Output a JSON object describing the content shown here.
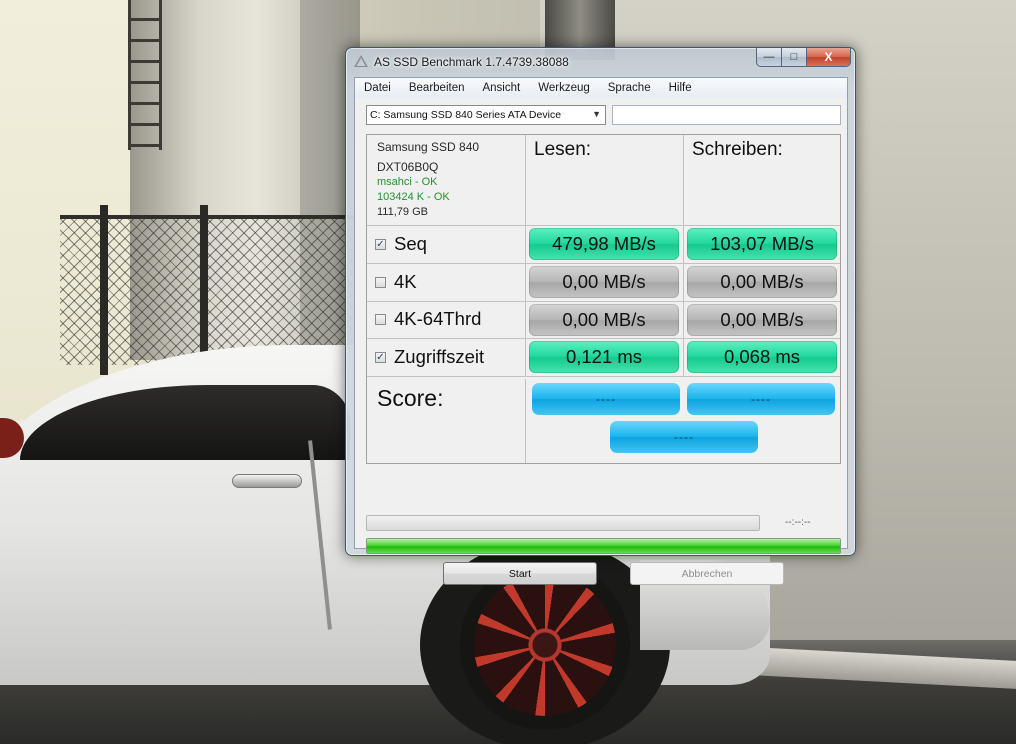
{
  "window": {
    "title": "AS SSD Benchmark 1.7.4739.38088",
    "caption": {
      "minimize": "—",
      "maximize": "□",
      "close": "X"
    }
  },
  "menu": [
    "Datei",
    "Bearbeiten",
    "Ansicht",
    "Werkzeug",
    "Sprache",
    "Hilfe"
  ],
  "drive": {
    "selected": "C: Samsung SSD 840 Series ATA Device",
    "extra_field": ""
  },
  "info": {
    "model": "Samsung SSD 840",
    "firmware": "DXT06B0Q",
    "driver_status": "msahci - OK",
    "alignment_status": "103424 K - OK",
    "capacity": "111,79 GB"
  },
  "columns": {
    "read": "Lesen:",
    "write": "Schreiben:"
  },
  "tests": [
    {
      "label": "Seq",
      "checked": true,
      "read": "479,98 MB/s",
      "write": "103,07 MB/s",
      "state": "done"
    },
    {
      "label": "4K",
      "checked": false,
      "read": "0,00 MB/s",
      "write": "0,00 MB/s",
      "state": "skipped"
    },
    {
      "label": "4K-64Thrd",
      "checked": false,
      "read": "0,00 MB/s",
      "write": "0,00 MB/s",
      "state": "skipped"
    },
    {
      "label": "Zugriffszeit",
      "checked": true,
      "read": "0,121 ms",
      "write": "0,068 ms",
      "state": "done"
    }
  ],
  "score": {
    "label": "Score:",
    "read": "----",
    "write": "----",
    "total": "----"
  },
  "progress": {
    "time_readout": "--:--:--",
    "overall_fraction": 1.0
  },
  "buttons": {
    "start": "Start",
    "cancel": "Abbrechen"
  },
  "colors": {
    "result_green": "#22d89d",
    "result_gray": "#b7b7b7",
    "score_blue": "#1cb6ee",
    "progress_green": "#22b90c"
  }
}
